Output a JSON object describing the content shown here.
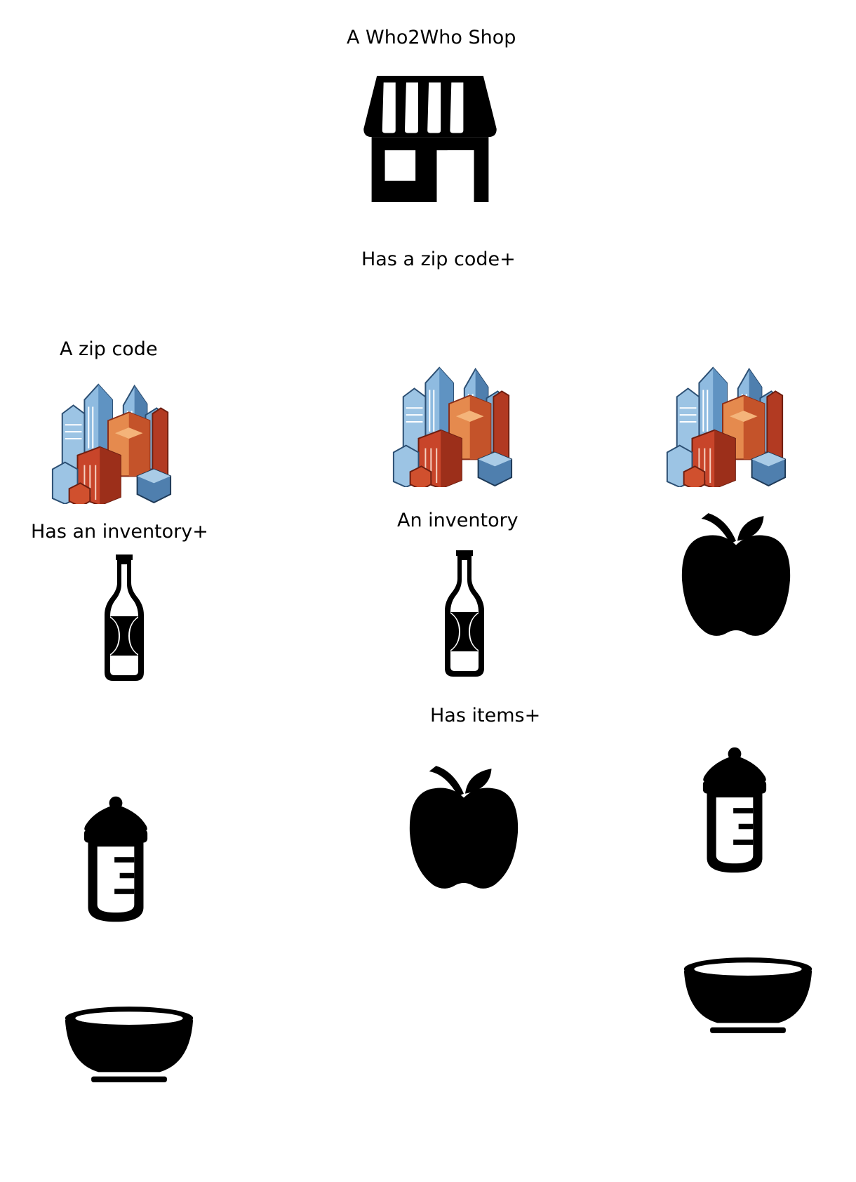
{
  "labels": {
    "shop": "A Who2Who Shop",
    "has_zip_code": "Has a zip code+",
    "zip_code": "A zip code",
    "has_inventory": "Has an inventory+",
    "inventory": "An inventory",
    "has_items": "Has items+"
  },
  "colors": {
    "icon_fill": "#000000",
    "building_blue": "#7fb0d8",
    "building_dark": "#2c4f73",
    "building_orange": "#d8643a",
    "building_red": "#b23a22"
  },
  "icons": {
    "shop": "storefront-icon",
    "city": "city-buildings-icon",
    "bottle": "bottle-icon",
    "apple": "apple-icon",
    "baby_bottle": "baby-bottle-icon",
    "bowl": "bowl-icon"
  }
}
